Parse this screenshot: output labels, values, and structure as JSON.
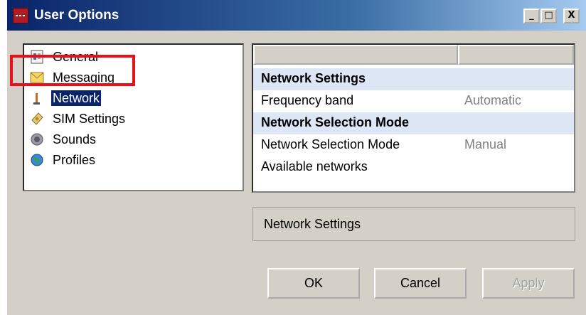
{
  "window": {
    "title": "User Options",
    "controls": {
      "minimize": "_",
      "maximize": "□",
      "close": "X"
    }
  },
  "sidebar": {
    "items": [
      {
        "label": "General",
        "icon": "general-icon",
        "selected": false
      },
      {
        "label": "Messaging",
        "icon": "envelope-icon",
        "selected": false
      },
      {
        "label": "Network",
        "icon": "network-icon",
        "selected": true
      },
      {
        "label": "SIM Settings",
        "icon": "sim-card-icon",
        "selected": false
      },
      {
        "label": "Sounds",
        "icon": "speaker-icon",
        "selected": false
      },
      {
        "label": "Profiles",
        "icon": "globe-icon",
        "selected": false
      }
    ],
    "highlight_color": "#e8111b"
  },
  "settings_grid": {
    "columns": [
      "",
      ""
    ],
    "rows": [
      {
        "name": "Network Settings",
        "value": "",
        "section": true
      },
      {
        "name": "Frequency band",
        "value": "Automatic",
        "section": false
      },
      {
        "name": "Network Selection Mode",
        "value": "",
        "section": true
      },
      {
        "name": "Network Selection Mode",
        "value": "Manual",
        "section": false
      },
      {
        "name": "Available networks",
        "value": "",
        "section": false
      }
    ]
  },
  "description": {
    "text": "Network Settings"
  },
  "buttons": {
    "ok": "OK",
    "cancel": "Cancel",
    "apply": "Apply"
  }
}
